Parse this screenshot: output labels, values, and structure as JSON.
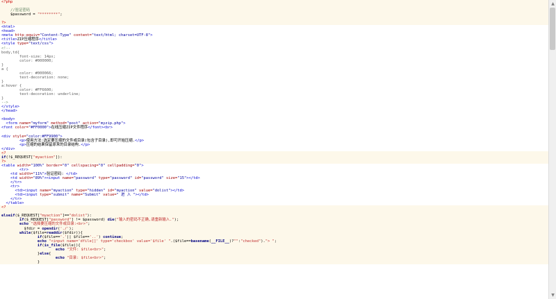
{
  "editor": {
    "lines": [
      {
        "t": "php",
        "s": [
          [
            "php",
            "<?php"
          ]
        ]
      },
      {
        "t": "php",
        "s": [
          [
            "txt",
            ""
          ]
        ]
      },
      {
        "t": "php",
        "s": [
          [
            "com",
            "    //验证密码"
          ]
        ]
      },
      {
        "t": "php",
        "s": [
          [
            "txt",
            "    $password = "
          ],
          [
            "str",
            "\"********\""
          ],
          [
            "txt",
            ";"
          ]
        ]
      },
      {
        "t": "php",
        "s": [
          [
            "txt",
            ""
          ]
        ]
      },
      {
        "t": "php",
        "s": [
          [
            "php",
            "?>"
          ]
        ]
      },
      {
        "t": "htm",
        "s": [
          [
            "tag",
            "<html>"
          ]
        ]
      },
      {
        "t": "htm",
        "s": [
          [
            "tag",
            "<head>"
          ]
        ]
      },
      {
        "t": "htm",
        "s": [
          [
            "tag",
            "<meta "
          ],
          [
            "att",
            "http-equiv="
          ],
          [
            "val",
            "\"Content-Type\""
          ],
          [
            "att",
            " content="
          ],
          [
            "val",
            "\"text/html; charset=UTF-8\""
          ],
          [
            "tag",
            ">"
          ]
        ]
      },
      {
        "t": "htm",
        "s": [
          [
            "tag",
            "<title>"
          ],
          [
            "txt",
            "ZIP压缩程序"
          ],
          [
            "tag",
            "</title>"
          ]
        ]
      },
      {
        "t": "htm",
        "s": [
          [
            "tag",
            "<style "
          ],
          [
            "att",
            "type="
          ],
          [
            "val",
            "\"text/css\""
          ],
          [
            "tag",
            ">"
          ]
        ]
      },
      {
        "t": "htm",
        "s": [
          [
            "com",
            "<!--"
          ]
        ]
      },
      {
        "t": "htm",
        "s": [
          [
            "css",
            "body,td{"
          ]
        ]
      },
      {
        "t": "htm",
        "s": [
          [
            "css",
            "        font-size: 14px;"
          ]
        ]
      },
      {
        "t": "htm",
        "s": [
          [
            "css",
            "        color: #000000;"
          ]
        ]
      },
      {
        "t": "htm",
        "s": [
          [
            "css",
            "}"
          ]
        ]
      },
      {
        "t": "htm",
        "s": [
          [
            "css",
            "a {"
          ]
        ]
      },
      {
        "t": "htm",
        "s": [
          [
            "css",
            "        color: #000066;"
          ]
        ]
      },
      {
        "t": "htm",
        "s": [
          [
            "css",
            "        text-decoration: none;"
          ]
        ]
      },
      {
        "t": "htm",
        "s": [
          [
            "css",
            "}"
          ]
        ]
      },
      {
        "t": "htm",
        "s": [
          [
            "css",
            "a:hover {"
          ]
        ]
      },
      {
        "t": "htm",
        "s": [
          [
            "css",
            "        color: #FF6600;"
          ]
        ]
      },
      {
        "t": "htm",
        "s": [
          [
            "css",
            "        text-decoration: underline;"
          ]
        ]
      },
      {
        "t": "htm",
        "s": [
          [
            "css",
            "}"
          ]
        ]
      },
      {
        "t": "htm",
        "s": [
          [
            "com",
            "-->"
          ]
        ]
      },
      {
        "t": "htm",
        "s": [
          [
            "tag",
            "</style>"
          ]
        ]
      },
      {
        "t": "htm",
        "s": [
          [
            "tag",
            "</head>"
          ]
        ]
      },
      {
        "t": "gap",
        "s": [
          [
            "txt",
            ""
          ]
        ]
      },
      {
        "t": "htm",
        "s": [
          [
            "tag",
            "<body>"
          ]
        ]
      },
      {
        "t": "htm",
        "s": [
          [
            "tag",
            "  <form "
          ],
          [
            "att",
            "name="
          ],
          [
            "val",
            "\"myform\""
          ],
          [
            "att",
            " method="
          ],
          [
            "val",
            "\"post\""
          ],
          [
            "att",
            " action="
          ],
          [
            "val",
            "\"myzip.php\""
          ],
          [
            "tag",
            ">"
          ]
        ]
      },
      {
        "t": "htm",
        "s": [
          [
            "tag",
            "<font "
          ],
          [
            "att",
            "color="
          ],
          [
            "val",
            "\"#FF0000\""
          ],
          [
            "tag",
            ">"
          ],
          [
            "txt",
            "在线压缩ZIP文件程序"
          ],
          [
            "tag",
            "</font><br>"
          ]
        ]
      },
      {
        "t": "gap",
        "s": [
          [
            "txt",
            ""
          ]
        ]
      },
      {
        "t": "htm",
        "s": [
          [
            "tag",
            "<div "
          ],
          [
            "att",
            "style="
          ],
          [
            "val",
            "\"color:#FF9900\""
          ],
          [
            "tag",
            ">"
          ]
        ]
      },
      {
        "t": "htm",
        "s": [
          [
            "tag",
            "        <p>"
          ],
          [
            "txt",
            "使用方法:选定要压缩的文件或目录(包含子目录),即可开始压缩."
          ],
          [
            "tag",
            "</p>"
          ]
        ]
      },
      {
        "t": "htm",
        "s": [
          [
            "tag",
            "        <p>"
          ],
          [
            "txt",
            "压缩的结果保留原来的目录结构."
          ],
          [
            "tag",
            "</p>"
          ]
        ]
      },
      {
        "t": "htm",
        "s": [
          [
            "tag",
            "</div>"
          ]
        ]
      },
      {
        "t": "php",
        "s": [
          [
            "php",
            "<?"
          ]
        ]
      },
      {
        "t": "php",
        "s": [
          [
            "kw",
            "if"
          ],
          [
            "txt",
            "(!$_REQUEST["
          ],
          [
            "str",
            "\"myaction\""
          ],
          [
            "txt",
            "]):"
          ]
        ]
      },
      {
        "t": "php",
        "s": [
          [
            "php",
            "?>"
          ]
        ]
      },
      {
        "t": "htm",
        "s": [
          [
            "tag",
            "<table "
          ],
          [
            "att",
            "width="
          ],
          [
            "val",
            "\"100%\""
          ],
          [
            "att",
            " border="
          ],
          [
            "val",
            "\"0\""
          ],
          [
            "att",
            " cellspacing="
          ],
          [
            "val",
            "\"0\""
          ],
          [
            "att",
            " cellpadding="
          ],
          [
            "val",
            "\"0\""
          ],
          [
            "tag",
            ">"
          ]
        ]
      },
      {
        "t": "htm",
        "s": [
          [
            "tag",
            "        <tr>"
          ]
        ]
      },
      {
        "t": "htm",
        "s": [
          [
            "tag",
            "    <td "
          ],
          [
            "att",
            "width="
          ],
          [
            "val",
            "\"11%\""
          ],
          [
            "tag",
            ">"
          ],
          [
            "txt",
            "验证密码: "
          ],
          [
            "tag",
            "</td>"
          ]
        ]
      },
      {
        "t": "htm",
        "s": [
          [
            "tag",
            "    <td "
          ],
          [
            "att",
            "width="
          ],
          [
            "val",
            "\"89%\""
          ],
          [
            "tag",
            "><input "
          ],
          [
            "att",
            "name="
          ],
          [
            "val",
            "\"password\""
          ],
          [
            "att",
            " type="
          ],
          [
            "val",
            "\"password\""
          ],
          [
            "att",
            " id="
          ],
          [
            "val",
            "\"password\""
          ],
          [
            "att",
            " size="
          ],
          [
            "val",
            "\"15\""
          ],
          [
            "tag",
            "></td>"
          ]
        ]
      },
      {
        "t": "htm",
        "s": [
          [
            "tag",
            "    </tr>"
          ]
        ]
      },
      {
        "t": "htm",
        "s": [
          [
            "tag",
            "    <tr>"
          ]
        ]
      },
      {
        "t": "htm",
        "s": [
          [
            "tag",
            "      <td><input "
          ],
          [
            "att",
            "name="
          ],
          [
            "val",
            "\"myaction\""
          ],
          [
            "att",
            " type="
          ],
          [
            "val",
            "\"hidden\""
          ],
          [
            "att",
            " id="
          ],
          [
            "val",
            "\"myaction\""
          ],
          [
            "att",
            " value="
          ],
          [
            "val",
            "\"dolist\""
          ],
          [
            "tag",
            "></td>"
          ]
        ]
      },
      {
        "t": "htm",
        "s": [
          [
            "tag",
            "      <td><input "
          ],
          [
            "att",
            "type="
          ],
          [
            "val",
            "\"submit\""
          ],
          [
            "att",
            " name="
          ],
          [
            "val",
            "\"Submit\""
          ],
          [
            "att",
            " value="
          ],
          [
            "val",
            "\" 进 入 \""
          ],
          [
            "tag",
            "></td>"
          ]
        ]
      },
      {
        "t": "htm",
        "s": [
          [
            "tag",
            "    </tr>"
          ]
        ]
      },
      {
        "t": "htm",
        "s": [
          [
            "tag",
            "  </table>"
          ]
        ]
      },
      {
        "t": "php",
        "s": [
          [
            "php",
            "<?"
          ]
        ]
      },
      {
        "t": "php",
        "s": [
          [
            "txt",
            ""
          ]
        ]
      },
      {
        "t": "php",
        "s": [
          [
            "kw",
            "elseif"
          ],
          [
            "txt",
            "($_REQUEST["
          ],
          [
            "str",
            "\"myaction\""
          ],
          [
            "txt",
            "]=="
          ],
          [
            "str",
            "\"dolist\""
          ],
          [
            "txt",
            "):"
          ]
        ]
      },
      {
        "t": "php",
        "s": [
          [
            "kw",
            "        if"
          ],
          [
            "txt",
            "($_REQUEST["
          ],
          [
            "str",
            "\"password\""
          ],
          [
            "txt",
            "] != $password) "
          ],
          [
            "fn",
            "die"
          ],
          [
            "txt",
            "("
          ],
          [
            "str",
            "\"输入的密码不正确,请重新输入.\""
          ],
          [
            "txt",
            ");"
          ]
        ]
      },
      {
        "t": "php",
        "s": [
          [
            "kw",
            "        echo "
          ],
          [
            "str",
            "\"选择要压缩的文件或目录:<br>\""
          ],
          [
            "txt",
            ";"
          ]
        ]
      },
      {
        "t": "php",
        "s": [
          [
            "txt",
            "          $fdir = "
          ],
          [
            "fn",
            "opendir"
          ],
          [
            "txt",
            "("
          ],
          [
            "str",
            "'./'"
          ],
          [
            "txt",
            ");"
          ]
        ]
      },
      {
        "t": "php",
        "s": [
          [
            "kw",
            "        while"
          ],
          [
            "txt",
            "($file="
          ],
          [
            "fn",
            "readdir"
          ],
          [
            "txt",
            "($fdir)){"
          ]
        ]
      },
      {
        "t": "php",
        "s": [
          [
            "kw",
            "                if"
          ],
          [
            "txt",
            "($file=="
          ],
          [
            "str",
            "'.'"
          ],
          [
            "txt",
            "|| $file=="
          ],
          [
            "str",
            "'..'"
          ],
          [
            "txt",
            ") "
          ],
          [
            "kw",
            "continue"
          ],
          [
            "txt",
            ";"
          ]
        ]
      },
      {
        "t": "php",
        "s": [
          [
            "kw",
            "                echo "
          ],
          [
            "str",
            "\"<input name='dfile[]' type='checkbox' value='$file' \""
          ],
          [
            "txt",
            ".($file=="
          ],
          [
            "fn",
            "basename"
          ],
          [
            "txt",
            "("
          ],
          [
            "kw",
            "__FILE__"
          ],
          [
            "txt",
            ")?"
          ],
          [
            "str",
            "\"\""
          ],
          [
            "txt",
            ":"
          ],
          [
            "str",
            "\"checked\""
          ],
          [
            "txt",
            ")."
          ],
          [
            "str",
            "\"> \""
          ],
          [
            "txt",
            ";"
          ]
        ]
      },
      {
        "t": "php",
        "s": [
          [
            "kw",
            "                if"
          ],
          [
            "txt",
            "("
          ],
          [
            "fn",
            "is_file"
          ],
          [
            "txt",
            "($file)){"
          ]
        ]
      },
      {
        "t": "php",
        "s": [
          [
            "kw",
            "                        echo "
          ],
          [
            "str",
            "\"文件: $file<br>\""
          ],
          [
            "txt",
            ";"
          ]
        ]
      },
      {
        "t": "php",
        "s": [
          [
            "txt",
            "                }"
          ],
          [
            "kw",
            "else"
          ],
          [
            "txt",
            "{"
          ]
        ]
      },
      {
        "t": "php",
        "s": [
          [
            "kw",
            "                        echo "
          ],
          [
            "str",
            "\"目录: $file<br>\""
          ],
          [
            "txt",
            ";"
          ]
        ]
      },
      {
        "t": "php",
        "s": [
          [
            "txt",
            "                }"
          ]
        ]
      }
    ]
  },
  "scrollbar": {
    "up_glyph": "▲",
    "down_glyph": "▼",
    "thumb_fraction": 0.15
  }
}
